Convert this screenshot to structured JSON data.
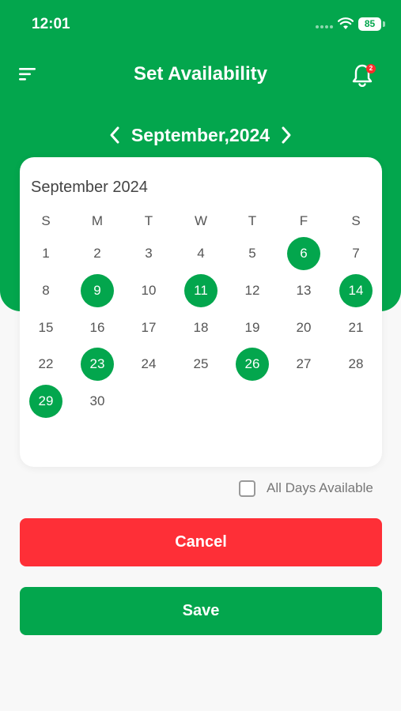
{
  "status_bar": {
    "time": "12:01",
    "battery": "85"
  },
  "header": {
    "title": "Set Availability",
    "notification_count": "2"
  },
  "month_nav": {
    "label": "September,2024"
  },
  "calendar": {
    "title": "September 2024",
    "weekdays": [
      "S",
      "M",
      "T",
      "W",
      "T",
      "F",
      "S"
    ],
    "weeks": [
      [
        "",
        "",
        "1",
        "2",
        "3",
        "4",
        "5"
      ],
      [
        "",
        "",
        "",
        "",
        "",
        "",
        ""
      ]
    ],
    "days": [
      "1",
      "2",
      "3",
      "4",
      "5",
      "6",
      "7",
      "8",
      "9",
      "10",
      "11",
      "12",
      "13",
      "14",
      "15",
      "16",
      "17",
      "18",
      "19",
      "20",
      "21",
      "22",
      "23",
      "24",
      "25",
      "26",
      "27",
      "28",
      "29",
      "30"
    ],
    "first_weekday_index": 0,
    "selected_days": [
      "6",
      "9",
      "11",
      "14",
      "23",
      "26",
      "29"
    ]
  },
  "all_days": {
    "label": "All Days Available",
    "checked": false
  },
  "buttons": {
    "cancel": "Cancel",
    "save": "Save"
  },
  "colors": {
    "primary": "#03a64d",
    "danger": "#fe2f37"
  }
}
